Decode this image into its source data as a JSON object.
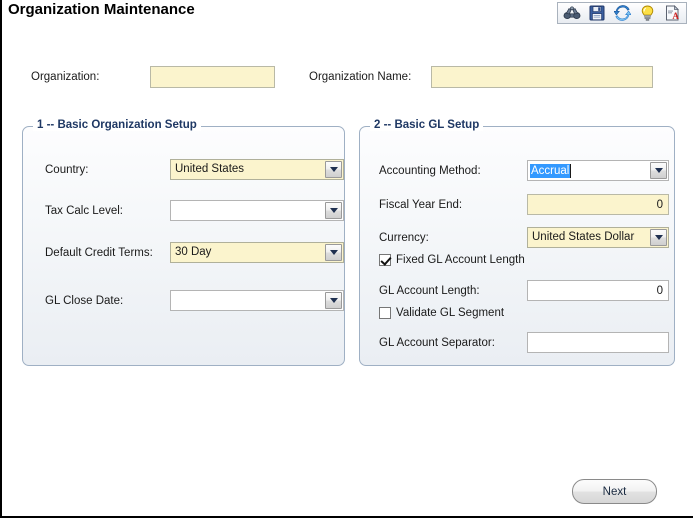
{
  "window": {
    "title": "Organization Maintenance"
  },
  "toolbar": {
    "buttons": [
      {
        "name": "binoculars-icon",
        "label": "Find"
      },
      {
        "name": "save-icon",
        "label": "Save"
      },
      {
        "name": "refresh-icon",
        "label": "Refresh"
      },
      {
        "name": "lightbulb-icon",
        "label": "Hint"
      },
      {
        "name": "report-icon",
        "label": "Report"
      }
    ]
  },
  "header_fields": {
    "organization": {
      "label": "Organization:",
      "value": "",
      "placeholder": ""
    },
    "organization_name": {
      "label": "Organization Name:",
      "value": "",
      "placeholder": ""
    }
  },
  "panel_left": {
    "title": "1 -- Basic Organization Setup",
    "fields": {
      "country": {
        "label": "Country:",
        "value": "United States"
      },
      "tax_calc_level": {
        "label": "Tax Calc Level:",
        "value": ""
      },
      "default_credit_terms": {
        "label": "Default Credit Terms:",
        "value": "30 Day"
      },
      "gl_close_date": {
        "label": "GL Close Date:",
        "value": ""
      }
    }
  },
  "panel_right": {
    "title": "2 -- Basic GL Setup",
    "fields": {
      "accounting_method": {
        "label": "Accounting Method:",
        "value": "Accrual"
      },
      "fiscal_year_end": {
        "label": "Fiscal Year End:",
        "value": "0"
      },
      "currency": {
        "label": "Currency:",
        "value": "United States Dollar"
      },
      "fixed_gl_account_length": {
        "label": "Fixed GL Account Length",
        "checked": true
      },
      "gl_account_length": {
        "label": "GL Account Length:",
        "value": "0"
      },
      "validate_gl_segment": {
        "label": "Validate GL Segment",
        "checked": false
      },
      "gl_account_separator": {
        "label": "GL Account Separator:",
        "value": ""
      }
    }
  },
  "footer": {
    "next_label": "Next"
  },
  "colors": {
    "required_field_bg": "#fbf4cd",
    "panel_title": "#1f3864",
    "selection": "#3399ff",
    "window_border": "#000000"
  }
}
